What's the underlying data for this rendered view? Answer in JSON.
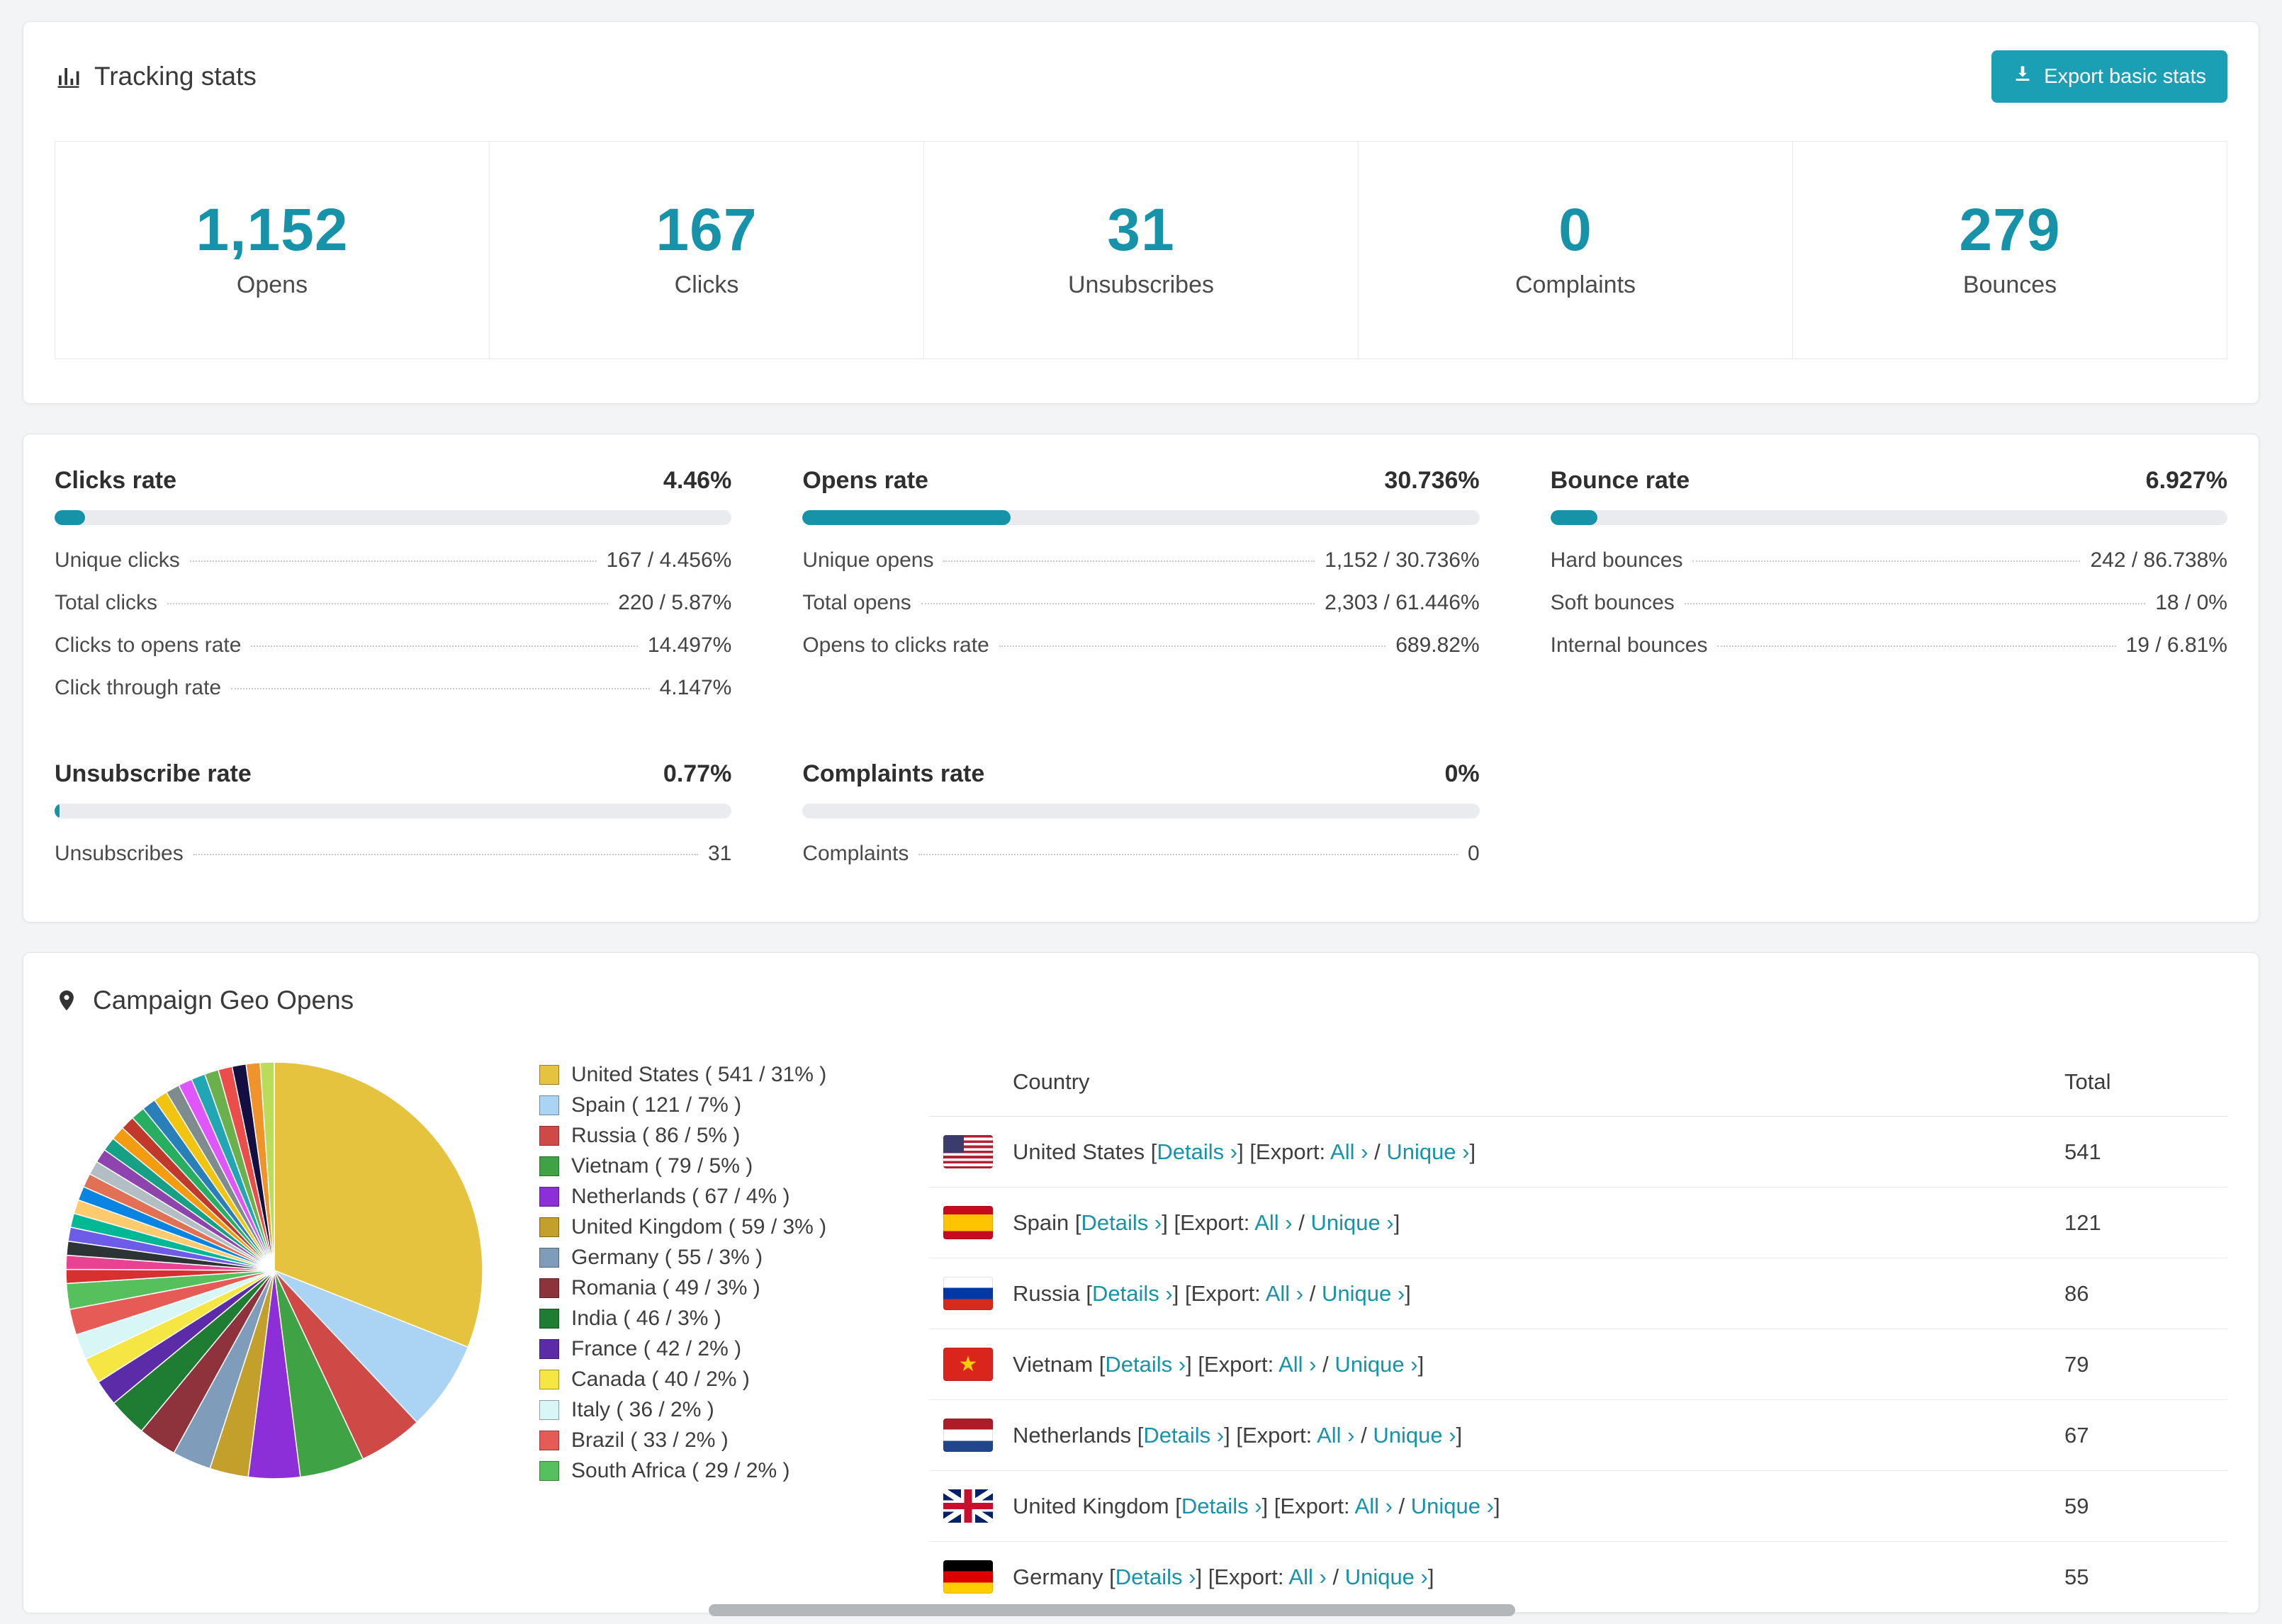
{
  "accent": "#1693a9",
  "button_color": "#1b9fb4",
  "tracking": {
    "title": "Tracking stats",
    "export_label": "Export basic stats",
    "stats": [
      {
        "value": "1,152",
        "label": "Opens"
      },
      {
        "value": "167",
        "label": "Clicks"
      },
      {
        "value": "31",
        "label": "Unsubscribes"
      },
      {
        "value": "0",
        "label": "Complaints"
      },
      {
        "value": "279",
        "label": "Bounces"
      }
    ]
  },
  "rates": [
    {
      "title": "Clicks rate",
      "percent": "4.46%",
      "bar": 4.46,
      "rows": [
        {
          "label": "Unique clicks",
          "value": "167 / 4.456%"
        },
        {
          "label": "Total clicks",
          "value": "220 / 5.87%"
        },
        {
          "label": "Clicks to opens rate",
          "value": "14.497%"
        },
        {
          "label": "Click through rate",
          "value": "4.147%"
        }
      ]
    },
    {
      "title": "Opens rate",
      "percent": "30.736%",
      "bar": 30.736,
      "rows": [
        {
          "label": "Unique opens",
          "value": "1,152 / 30.736%"
        },
        {
          "label": "Total opens",
          "value": "2,303 / 61.446%"
        },
        {
          "label": "Opens to clicks rate",
          "value": "689.82%"
        }
      ]
    },
    {
      "title": "Bounce rate",
      "percent": "6.927%",
      "bar": 6.927,
      "rows": [
        {
          "label": "Hard bounces",
          "value": "242 / 86.738%"
        },
        {
          "label": "Soft bounces",
          "value": "18 / 0%"
        },
        {
          "label": "Internal bounces",
          "value": "19 / 6.81%"
        }
      ]
    },
    {
      "title": "Unsubscribe rate",
      "percent": "0.77%",
      "bar": 0.77,
      "rows": [
        {
          "label": "Unsubscribes",
          "value": "31"
        }
      ]
    },
    {
      "title": "Complaints rate",
      "percent": "0%",
      "bar": 0,
      "rows": [
        {
          "label": "Complaints",
          "value": "0"
        }
      ]
    }
  ],
  "geo": {
    "title": "Campaign Geo Opens",
    "table": {
      "headers": [
        "Country",
        "Total"
      ],
      "link_labels": {
        "open": "[",
        "close": "]",
        "details": "Details ›",
        "export_prefix": "Export:",
        "all": "All ›",
        "separator": "/",
        "unique": "Unique ›"
      },
      "rows": [
        {
          "country": "United States",
          "flag": "us",
          "total": "541"
        },
        {
          "country": "Spain",
          "flag": "es",
          "total": "121"
        },
        {
          "country": "Russia",
          "flag": "ru",
          "total": "86"
        },
        {
          "country": "Vietnam",
          "flag": "vn",
          "total": "79"
        },
        {
          "country": "Netherlands",
          "flag": "nl",
          "total": "67"
        },
        {
          "country": "United Kingdom",
          "flag": "gb",
          "total": "59"
        },
        {
          "country": "Germany",
          "flag": "de",
          "total": "55"
        }
      ]
    }
  },
  "chart_data": {
    "type": "pie",
    "title": "Campaign Geo Opens",
    "legend_format": "{label} ( {value} / {percent}% )",
    "slices": [
      {
        "label": "United States",
        "value": 541,
        "percent": 31,
        "color": "#e6c33e"
      },
      {
        "label": "Spain",
        "value": 121,
        "percent": 7,
        "color": "#abd4f4"
      },
      {
        "label": "Russia",
        "value": 86,
        "percent": 5,
        "color": "#cf4a46"
      },
      {
        "label": "Vietnam",
        "value": 79,
        "percent": 5,
        "color": "#3fa346"
      },
      {
        "label": "Netherlands",
        "value": 67,
        "percent": 4,
        "color": "#8c2fd9"
      },
      {
        "label": "United Kingdom",
        "value": 59,
        "percent": 3,
        "color": "#c3a02b"
      },
      {
        "label": "Germany",
        "value": 55,
        "percent": 3,
        "color": "#7f9cba"
      },
      {
        "label": "Romania",
        "value": 49,
        "percent": 3,
        "color": "#8e323c"
      },
      {
        "label": "India",
        "value": 46,
        "percent": 3,
        "color": "#1f7c33"
      },
      {
        "label": "France",
        "value": 42,
        "percent": 2,
        "color": "#5c2ca8"
      },
      {
        "label": "Canada",
        "value": 40,
        "percent": 2,
        "color": "#f6e644"
      },
      {
        "label": "Italy",
        "value": 36,
        "percent": 2,
        "color": "#d9f6f6"
      },
      {
        "label": "Brazil",
        "value": 33,
        "percent": 2,
        "color": "#e75b56"
      },
      {
        "label": "South Africa",
        "value": 29,
        "percent": 2,
        "color": "#56c15c"
      }
    ],
    "others": {
      "percent": 26,
      "colors": [
        "#d63031",
        "#e84393",
        "#2d3436",
        "#6c5ce7",
        "#00b894",
        "#fdcb6e",
        "#0984e3",
        "#e17055",
        "#b2bec3",
        "#8e44ad",
        "#16a085",
        "#f39c12",
        "#c0392b",
        "#27ae60",
        "#2980b9",
        "#f1c40f",
        "#7f8c8d",
        "#e056fd",
        "#22a6b3",
        "#6ab04c",
        "#eb4d4b",
        "#130f40",
        "#f0932b",
        "#badc58"
      ]
    }
  }
}
